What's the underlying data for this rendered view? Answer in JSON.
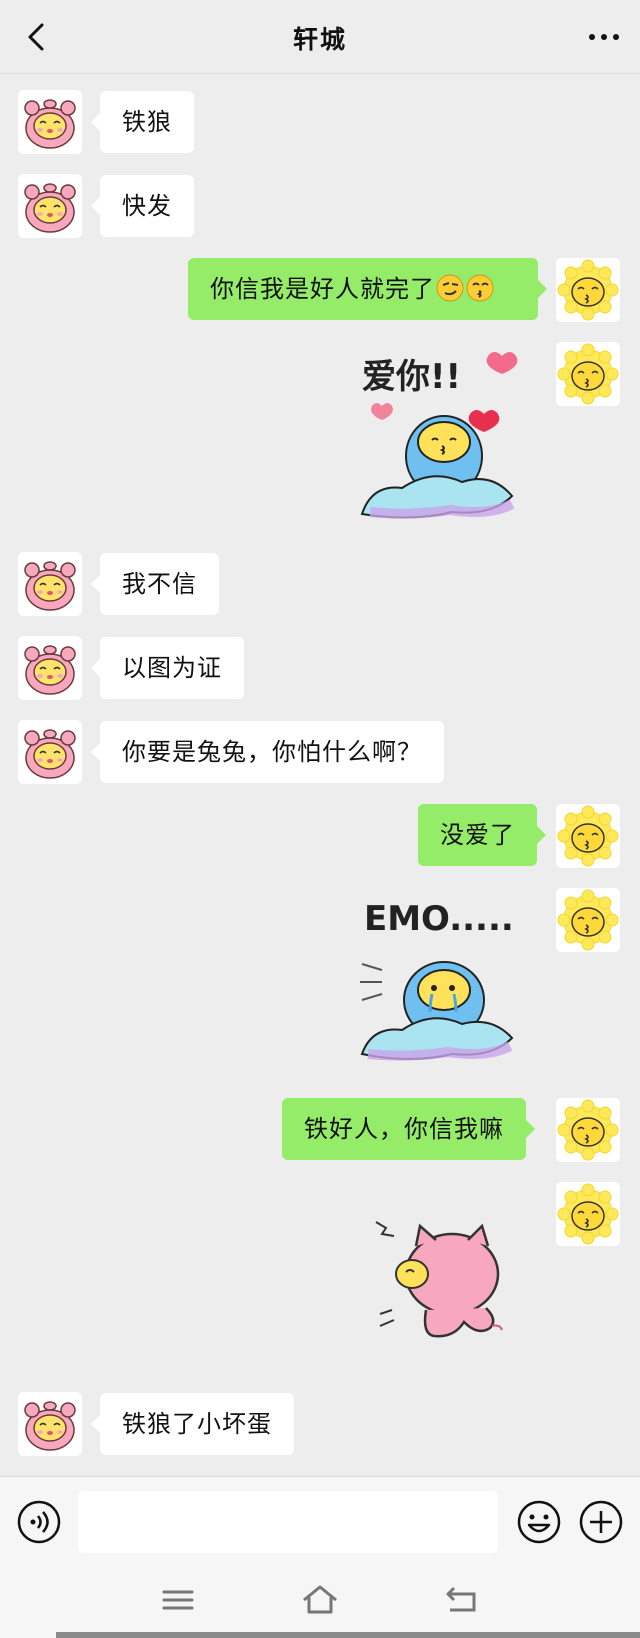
{
  "header": {
    "title": "轩城"
  },
  "messages": [
    {
      "side": "left",
      "type": "text",
      "text": "铁狼"
    },
    {
      "side": "left",
      "type": "text",
      "text": "快发"
    },
    {
      "side": "right",
      "type": "text",
      "text": "你信我是好人就完了"
    },
    {
      "side": "right",
      "type": "sticker",
      "caption": "爱你!!"
    },
    {
      "side": "left",
      "type": "text",
      "text": "我不信"
    },
    {
      "side": "left",
      "type": "text",
      "text": "以图为证"
    },
    {
      "side": "left",
      "type": "text",
      "text": "你要是兔兔，你怕什么啊？"
    },
    {
      "side": "right",
      "type": "text",
      "text": "没爱了"
    },
    {
      "side": "right",
      "type": "sticker",
      "caption": "EMO....."
    },
    {
      "side": "right",
      "type": "text",
      "text": "铁好人，你信我嘛"
    },
    {
      "side": "right",
      "type": "sticker",
      "caption": ""
    },
    {
      "side": "left",
      "type": "text",
      "text": "铁狼了小坏蛋"
    }
  ],
  "input": {
    "placeholder": ""
  },
  "icons": {
    "back": "chevron-left-icon",
    "more": "more-dots-icon",
    "voice": "voice-icon",
    "emoji": "emoji-icon",
    "plus": "plus-icon",
    "menu": "menu-icon",
    "home": "home-icon",
    "nav_back": "back-arrow-icon"
  },
  "colors": {
    "background": "#ededed",
    "bubble_right": "#95ec69",
    "bubble_left": "#ffffff"
  }
}
